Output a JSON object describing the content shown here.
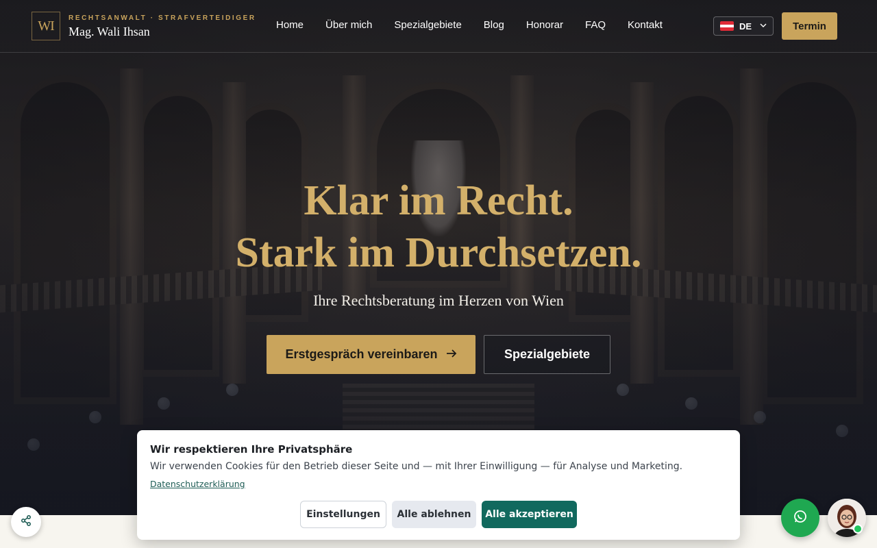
{
  "brand": {
    "monogram": "WI",
    "kicker": "Rechtsanwalt · Strafverteidiger",
    "name": "Mag. Wali Ihsan"
  },
  "nav": {
    "items": [
      {
        "label": "Home"
      },
      {
        "label": "Über mich"
      },
      {
        "label": "Spezialgebiete"
      },
      {
        "label": "Blog"
      },
      {
        "label": "Honorar"
      },
      {
        "label": "FAQ"
      },
      {
        "label": "Kontakt"
      }
    ]
  },
  "language": {
    "code": "DE",
    "flag": "austria-flag-icon"
  },
  "header_cta": {
    "label": "Termin"
  },
  "hero": {
    "title_line1": "Klar im Recht.",
    "title_line2": "Stark im Durchsetzen.",
    "subtitle": "Ihre Rechtsberatung im Herzen von Wien",
    "primary_cta": "Erstgespräch vereinbaren",
    "secondary_cta": "Spezialgebiete"
  },
  "cookie_banner": {
    "title": "Wir respektieren Ihre Privatsphäre",
    "text": "Wir verwenden Cookies für den Betrieb dieser Seite und — mit Ihrer Einwilligung — für Analyse und Marketing.",
    "privacy_link": "Datenschutzerklärung",
    "settings_label": "Einstellungen",
    "reject_label": "Alle ablehnen",
    "accept_label": "Alle akzeptieren"
  },
  "floating": {
    "share_icon": "share-icon",
    "whatsapp_icon": "whatsapp-icon",
    "assistant_icon": "assistant-avatar"
  },
  "colors": {
    "gold": "#c9a45c",
    "accept_green": "#11695e",
    "whatsapp_green": "#1fa851"
  }
}
